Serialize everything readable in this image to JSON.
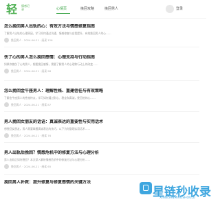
{
  "header": {
    "logo_main": "轻",
    "logo_sub": "情感记录",
    "nav": [
      {
        "label": "心情页"
      },
      {
        "label": "挽回攻略"
      },
      {
        "label": "挽回男人"
      }
    ],
    "login_label": "登录"
  },
  "articles": [
    {
      "title": "怎么挽回男人出轨的心：有效方法与情感修复指南",
      "desc": "了解男人出轨的心理原因，学习如何通过沟通、情感修复与自我提升，有效挽回男人的心……",
      "meta": "挽回男人  ·  2024-06-21  ·  阅读 126"
    },
    {
      "title": "伤了心的男人怎么挽回感情：心理支持与行动指南",
      "desc": "如果你曾伤了心的男人，想要挽回感情，需要了解男人的心理和行动上的改变……",
      "meta": "挽回男人  ·  2024-06-21  ·  阅读 98"
    },
    {
      "title": "怎么挽回金牛座男人：理解性格、重建信任与有效策略",
      "desc": "了解金牛座男人的性格特点，学习如何通过耐心、稳定和真诚，挽回他的心……",
      "meta": "挽回男人  ·  2024-06-21  ·  阅读 87"
    },
    {
      "title": "男人挽回女朋友的话语：真诚表达的重要性与实用话术",
      "desc": "想挽回女朋友，男人需要掌握真诚表达的技巧，以下为你整理实用话术……",
      "meta": "挽回男人  ·  2024-06-21  ·  阅读 76"
    },
    {
      "title": "男人出轨后挽回？情感危机中的修复方法与心理分析",
      "desc": "男人出轨后如何挽回？本文深入解析情感危机中的修复方法与心理分析……",
      "meta": "挽回男人  ·  2024-06-21  ·  阅读 65"
    },
    {
      "title": "挽回男人补救：提升修复与修复感情的关键方法",
      "desc": "",
      "meta": ""
    }
  ],
  "watermark": {
    "text": "星链秒收录",
    "sub": "XINGLIANMIAOSHOULU"
  },
  "colors": {
    "accent": "#2e9e3a",
    "watermark": "#3ea6df"
  }
}
